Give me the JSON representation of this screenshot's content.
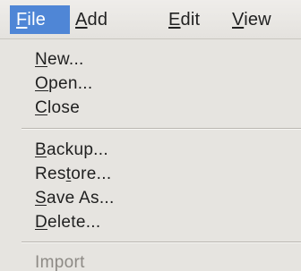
{
  "menubar": {
    "items": [
      {
        "label": "File",
        "mnemonic": "F",
        "rest": "ile",
        "state": "active"
      },
      {
        "label": "Add",
        "mnemonic": "A",
        "rest": "dd"
      },
      {
        "label": "Edit",
        "mnemonic": "E",
        "rest": "dit"
      },
      {
        "label": "View",
        "mnemonic": "V",
        "rest": "iew"
      }
    ],
    "active_bg": "#4f86d6"
  },
  "file_menu": {
    "groups": [
      [
        {
          "label": "New...",
          "pre": "",
          "mnemonic": "N",
          "post": "ew..."
        },
        {
          "label": "Open...",
          "pre": "",
          "mnemonic": "O",
          "post": "pen..."
        },
        {
          "label": "Close",
          "pre": "",
          "mnemonic": "C",
          "post": "lose"
        }
      ],
      [
        {
          "label": "Backup...",
          "pre": "",
          "mnemonic": "B",
          "post": "ackup..."
        },
        {
          "label": "Restore...",
          "pre": "Res",
          "mnemonic": "t",
          "post": "ore..."
        },
        {
          "label": "Save As...",
          "pre": "",
          "mnemonic": "S",
          "post": "ave As..."
        },
        {
          "label": "Delete...",
          "pre": "",
          "mnemonic": "D",
          "post": "elete..."
        }
      ],
      [
        {
          "label": "Import",
          "pre": "",
          "mnemonic": "",
          "post": "Import",
          "state": "disabled"
        }
      ]
    ]
  }
}
